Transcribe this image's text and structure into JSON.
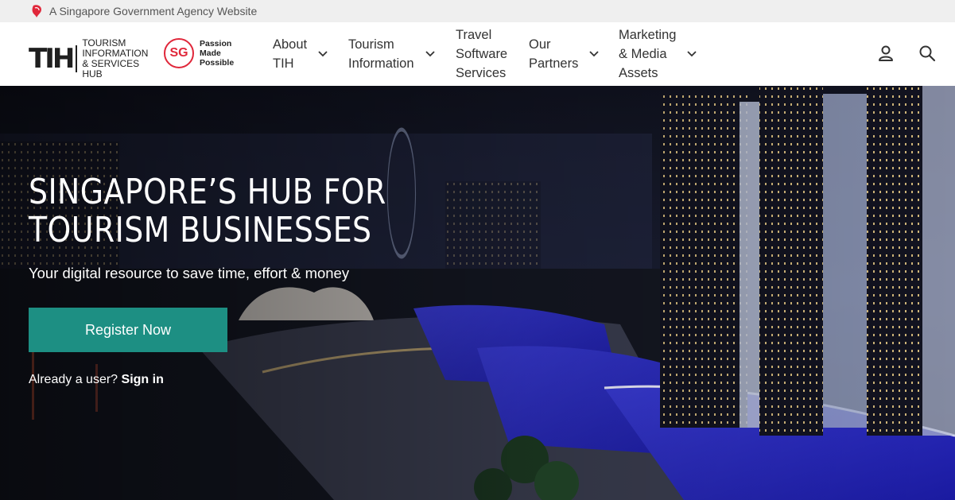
{
  "gov_banner": {
    "text": "A Singapore Government Agency Website"
  },
  "logo": {
    "mark": "TIH",
    "line1": "TOURISM",
    "line2": "INFORMATION",
    "line3": "& SERVICES HUB",
    "sg_mark": "SG",
    "sg_line1": "Passion",
    "sg_line2": "Made",
    "sg_line3": "Possible"
  },
  "nav": [
    {
      "label": "About\nTIH",
      "has_dropdown": true
    },
    {
      "label": "Tourism\nInformation",
      "has_dropdown": true
    },
    {
      "label": "Travel\nSoftware\nServices",
      "has_dropdown": false
    },
    {
      "label": "Our\nPartners",
      "has_dropdown": true
    },
    {
      "label": "Marketing\n& Media\nAssets",
      "has_dropdown": true
    }
  ],
  "header_icons": [
    "user-icon",
    "search-icon"
  ],
  "hero": {
    "title_line1": "SINGAPORE’S HUB FOR",
    "title_line2": "TOURISM BUSINESSES",
    "subtitle": "Your digital resource to save time, effort & money",
    "register_button": "Register Now",
    "already_text": "Already a user?",
    "signin_text": "Sign in"
  },
  "colors": {
    "accent": "#1d8f83",
    "sg_red": "#e0273a",
    "gov_bar": "#efefef"
  }
}
